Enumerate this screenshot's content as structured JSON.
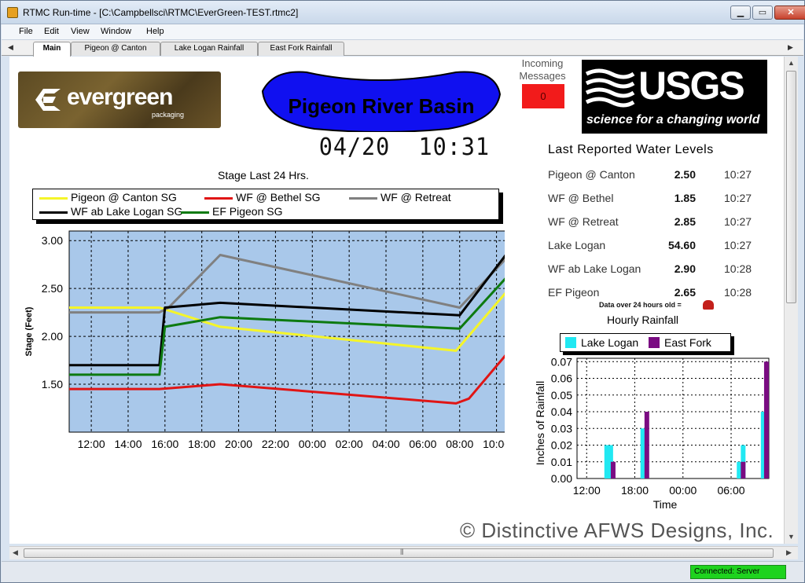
{
  "window": {
    "title": "RTMC Run-time - [C:\\Campbellsci\\RTMC\\EverGreen-TEST.rtmc2]",
    "minimize": "▁",
    "maximize": "▭",
    "close": "✕"
  },
  "menu": [
    "File",
    "Edit",
    "View",
    "Window",
    "Help"
  ],
  "tabs": [
    "Main",
    "Pigeon @ Canton",
    "Lake Logan Rainfall",
    "East Fork Rainfall"
  ],
  "logos": {
    "evergreen": "evergreen",
    "evergreen_sub": "packaging",
    "usgs": "USGS",
    "usgs_tagline": "science for a changing world"
  },
  "basin_title": "Pigeon River Basin",
  "clock": "04/20  10:31",
  "incoming": {
    "label": "Incoming Messages",
    "count": "0"
  },
  "last_reported": {
    "title": "Last Reported Water Levels",
    "rows": [
      {
        "name": "Pigeon @ Canton",
        "value": "2.50",
        "time": "10:27"
      },
      {
        "name": "WF @ Bethel",
        "value": "1.85",
        "time": "10:27"
      },
      {
        "name": "WF @ Retreat",
        "value": "2.85",
        "time": "10:27"
      },
      {
        "name": "Lake Logan",
        "value": "54.60",
        "time": "10:27"
      },
      {
        "name": "WF ab Lake Logan",
        "value": "2.90",
        "time": "10:28"
      },
      {
        "name": "EF Pigeon",
        "value": "2.65",
        "time": "10:28"
      }
    ],
    "note": "Data over 24 hours old ="
  },
  "stage_title": "Stage Last 24 Hrs.",
  "hourly_title": "Hourly Rainfall",
  "copyright": "© Distinctive AFWS Designs, Inc.",
  "status": {
    "connection": "Connected: Server"
  },
  "colors": {
    "plot_bg": "#a9c8ea",
    "canton": "#f5f529",
    "bethel": "#e01515",
    "retreat": "#808080",
    "ablogan": "#000000",
    "efpigeon": "#0d7a10",
    "lake_logan_rain": "#21e8f2",
    "east_fork_rain": "#7a0c82",
    "basin_fill": "#1010f0"
  },
  "chart_data": [
    {
      "type": "line",
      "ylabel": "Stage (Feet)",
      "ylim": [
        1.0,
        3.1
      ],
      "yticks": [
        "3.00",
        "2.50",
        "2.00",
        "1.50"
      ],
      "xticks": [
        "12:00",
        "14:00",
        "16:00",
        "18:00",
        "20:00",
        "22:00",
        "00:00",
        "02:00",
        "04:00",
        "06:00",
        "08:00",
        "10:00"
      ],
      "x_unit": "hours from 12:00",
      "xlim": [
        -1.2,
        22.7
      ],
      "grid": true,
      "legend_position": "top",
      "series": [
        {
          "name": "Pigeon @ Canton SG",
          "color_key": "canton",
          "points": [
            [
              -1.2,
              2.3
            ],
            [
              3.7,
              2.3
            ],
            [
              7.0,
              2.1
            ],
            [
              19.8,
              1.85
            ],
            [
              22.7,
              2.5
            ]
          ]
        },
        {
          "name": "WF @ Bethel SG",
          "color_key": "bethel",
          "points": [
            [
              -1.2,
              1.45
            ],
            [
              3.7,
              1.45
            ],
            [
              7.0,
              1.5
            ],
            [
              19.8,
              1.3
            ],
            [
              20.5,
              1.35
            ],
            [
              22.7,
              1.85
            ]
          ]
        },
        {
          "name": "WF @ Retreat",
          "color_key": "retreat",
          "points": [
            [
              -1.2,
              2.25
            ],
            [
              3.7,
              2.25
            ],
            [
              4.2,
              2.3
            ],
            [
              7.0,
              2.85
            ],
            [
              20.0,
              2.3
            ],
            [
              22.7,
              2.85
            ]
          ]
        },
        {
          "name": "WF ab Lake Logan SG",
          "color_key": "ablogan",
          "points": [
            [
              -1.2,
              1.7
            ],
            [
              3.7,
              1.7
            ],
            [
              4.0,
              2.3
            ],
            [
              7.0,
              2.35
            ],
            [
              20.0,
              2.22
            ],
            [
              22.7,
              2.9
            ]
          ]
        },
        {
          "name": "EF Pigeon SG",
          "color_key": "efpigeon",
          "points": [
            [
              -1.2,
              1.6
            ],
            [
              3.7,
              1.6
            ],
            [
              4.0,
              2.1
            ],
            [
              7.0,
              2.2
            ],
            [
              20.0,
              2.08
            ],
            [
              22.7,
              2.65
            ]
          ]
        }
      ]
    },
    {
      "type": "bar",
      "ylabel": "Inches of Rainfall",
      "xlabel": "Time",
      "ylim": [
        0,
        0.072
      ],
      "yticks": [
        "0.07",
        "0.06",
        "0.05",
        "0.04",
        "0.03",
        "0.02",
        "0.01",
        "0.00"
      ],
      "xticks": [
        "12:00",
        "18:00",
        "00:00",
        "06:00"
      ],
      "x_unit": "hours from 12:00",
      "xlim": [
        -1.2,
        22.7
      ],
      "series": [
        {
          "name": "Lake Logan",
          "color_key": "lake_logan_rain",
          "points": [
            [
              2.5,
              0.02
            ],
            [
              3.0,
              0.02
            ],
            [
              7.0,
              0.03
            ],
            [
              19.0,
              0.01
            ],
            [
              19.5,
              0.02
            ],
            [
              22.0,
              0.04
            ]
          ]
        },
        {
          "name": "East Fork",
          "color_key": "east_fork_rain",
          "points": [
            [
              3.3,
              0.01
            ],
            [
              7.5,
              0.04
            ],
            [
              19.5,
              0.01
            ],
            [
              22.4,
              0.07
            ]
          ]
        }
      ]
    }
  ]
}
